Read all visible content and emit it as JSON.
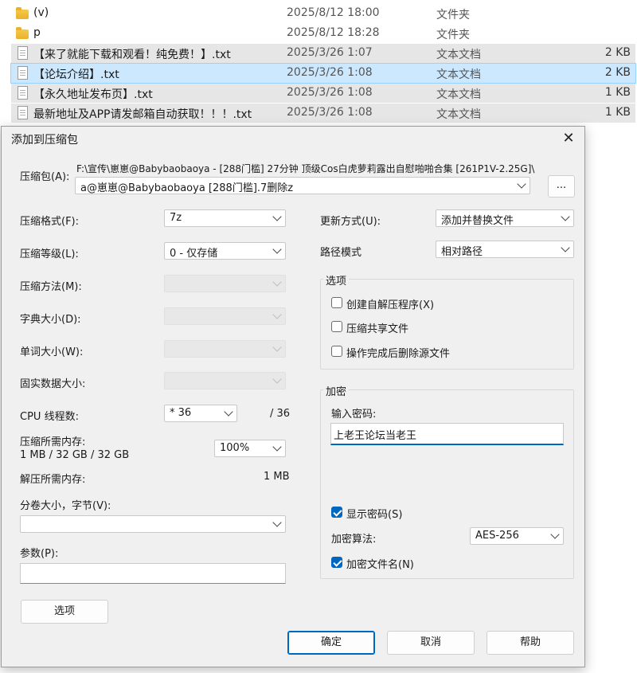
{
  "file_list": {
    "rows": [
      {
        "name": "(v)",
        "date": "2025/8/12 18:00",
        "type": "文件夹",
        "size": "",
        "icon": "folder-icon"
      },
      {
        "name": "p",
        "date": "2025/8/12 18:28",
        "type": "文件夹",
        "size": "",
        "icon": "folder-icon"
      },
      {
        "name": "【来了就能下载和观看！纯免费！】.txt",
        "date": "2025/3/26 1:07",
        "type": "文本文档",
        "size": "2 KB",
        "icon": "text-file-icon"
      },
      {
        "name": "【论坛介绍】.txt",
        "date": "2025/3/26 1:08",
        "type": "文本文档",
        "size": "2 KB",
        "icon": "text-file-icon"
      },
      {
        "name": "【永久地址发布页】.txt",
        "date": "2025/3/26 1:08",
        "type": "文本文档",
        "size": "1 KB",
        "icon": "text-file-icon"
      },
      {
        "name": "最新地址及APP请发邮箱自动获取！！！.txt",
        "date": "2025/3/26 1:08",
        "type": "文本文档",
        "size": "1 KB",
        "icon": "text-file-icon"
      }
    ]
  },
  "dialog": {
    "title": "添加到压缩包",
    "close_glyph": "✕",
    "archive": {
      "label": "压缩包(A):",
      "path": "F:\\宣传\\崽崽@Babybaobaoya - [288门槛] 27分钟 顶级Cos白虎萝莉露出自慰啪啪合集 [261P1V-2.25G]\\",
      "name_value": "a@崽崽@Babybaobaoya [288门槛].7删除z",
      "browse_label": "..."
    },
    "left": {
      "format_label": "压缩格式(F):",
      "format_value": "7z",
      "level_label": "压缩等级(L):",
      "level_value": "0 - 仅存储",
      "method_label": "压缩方法(M):",
      "dict_label": "字典大小(D):",
      "word_label": "单词大小(W):",
      "solid_label": "固实数据大小:",
      "threads_label": "CPU 线程数:",
      "threads_value": "* 36",
      "threads_max": "/ 36",
      "mem_comp_label": "压缩所需内存:",
      "mem_comp_value": "1 MB / 32 GB / 32 GB",
      "mem_percent": "100%",
      "mem_decomp_label": "解压所需内存:",
      "mem_decomp_value": "1 MB",
      "volume_label": "分卷大小，字节(V):",
      "volume_value": "",
      "params_label": "参数(P):",
      "params_value": "",
      "options_button": "选项"
    },
    "right": {
      "update_label": "更新方式(U):",
      "update_value": "添加并替换文件",
      "path_label": "路径模式",
      "path_value": "相对路径",
      "options_group": "选项",
      "opt_sfx": "创建自解压程序(X)",
      "opt_sfx_checked": false,
      "opt_shared": "压缩共享文件",
      "opt_shared_checked": false,
      "opt_delete": "操作完成后删除源文件",
      "opt_delete_checked": false,
      "encryption_group": "加密",
      "password_label": "输入密码:",
      "password_value": "上老王论坛当老王",
      "show_password": "显示密码(S)",
      "show_password_checked": true,
      "enc_method_label": "加密算法:",
      "enc_method_value": "AES-256",
      "encrypt_names": "加密文件名(N)",
      "encrypt_names_checked": true
    },
    "buttons": {
      "ok": "确定",
      "cancel": "取消",
      "help": "帮助"
    }
  },
  "colors": {
    "accent": "#0067c0",
    "selection": "#cce8ff",
    "dialog_bg": "#f0f0f0"
  }
}
